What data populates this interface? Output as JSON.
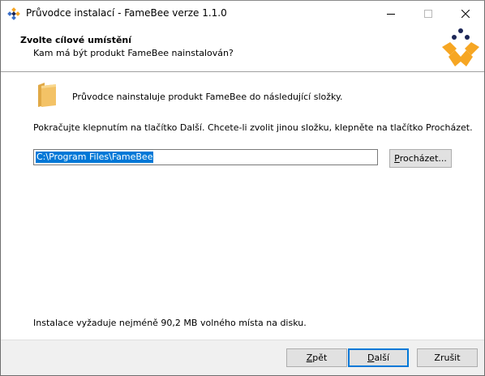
{
  "window": {
    "title": "Průvodce instalací - FameBee verze 1.1.0"
  },
  "header": {
    "title": "Zvolte cílové umístění",
    "subtitle": "Kam má být produkt FameBee nainstalován?"
  },
  "content": {
    "intro": "Průvodce nainstaluje produkt FameBee do následující složky.",
    "instruction": "Pokračujte klepnutím na tlačítko Další. Chcete-li zvolit jinou složku, klepněte na tlačítko Procházet.",
    "path": "C:\\Program Files\\FameBee",
    "browse_pre": "",
    "browse_key": "P",
    "browse_rest": "rocházet...",
    "space_required": "Instalace vyžaduje nejméně 90,2 MB volného místa na disku."
  },
  "footer": {
    "back_key": "Z",
    "back_rest": "pět",
    "next_key": "D",
    "next_rest": "alší",
    "cancel_label": "Zrušit"
  },
  "colors": {
    "accent": "#0078d7",
    "logo_orange": "#f6a623",
    "logo_navy": "#1c2657",
    "folder": "#f0c060"
  },
  "icons": [
    "app-icon",
    "minimize-icon",
    "maximize-icon",
    "close-icon",
    "famebee-logo",
    "folder-icon"
  ]
}
